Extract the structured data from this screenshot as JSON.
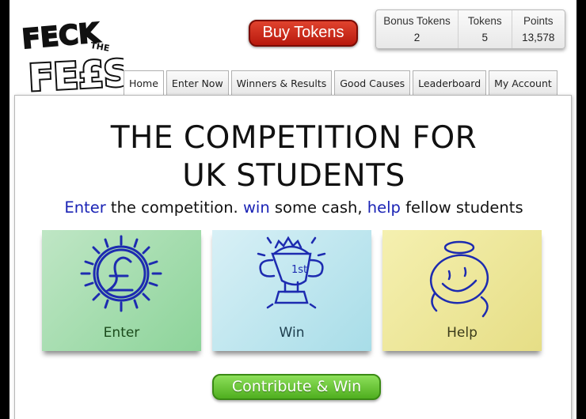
{
  "header": {
    "logo_text": "FECK THE FEES",
    "buy_tokens_label": "Buy Tokens",
    "stats": [
      {
        "label": "Bonus Tokens",
        "value": "2"
      },
      {
        "label": "Tokens",
        "value": "5"
      },
      {
        "label": "Points",
        "value": "13,578"
      }
    ]
  },
  "tabs": [
    {
      "label": "Home",
      "active": true
    },
    {
      "label": "Enter Now"
    },
    {
      "label": "Winners & Results"
    },
    {
      "label": "Good Causes"
    },
    {
      "label": "Leaderboard"
    },
    {
      "label": "My Account"
    }
  ],
  "main": {
    "headline_line1": "THE COMPETITION FOR",
    "headline_line2": "UK STUDENTS",
    "tagline": {
      "kw1": "Enter",
      "t1": " the competition. ",
      "kw2": "win",
      "t2": " some cash, ",
      "kw3": "help",
      "t3": " fellow students"
    },
    "cards": [
      {
        "label": "Enter",
        "icon": "pound-sun-icon"
      },
      {
        "label": "Win",
        "icon": "trophy-icon"
      },
      {
        "label": "Help",
        "icon": "smiley-icon"
      }
    ],
    "contribute_label": "Contribute & Win"
  },
  "colors": {
    "buy_button": "#c8200f",
    "contribute_button": "#5dbd2a",
    "keyword_blue": "#1a23b5",
    "enter_card": "#a8dcb2",
    "win_card": "#bfe6ef",
    "help_card": "#eee69c"
  }
}
